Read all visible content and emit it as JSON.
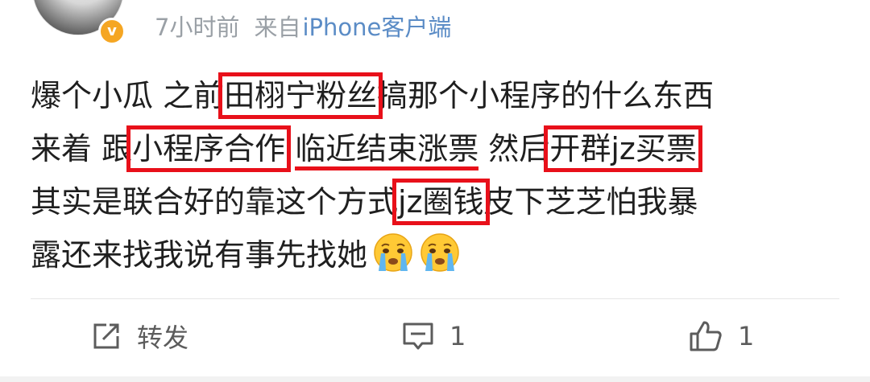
{
  "header": {
    "time": "7小时前",
    "source_prefix": "来自",
    "source_device": "iPhone客户端"
  },
  "vip_badge_letter": "v",
  "post": {
    "lines": [
      [
        "爆个小瓜 之前",
        "田栩宁粉丝",
        "搞那个小程序的什么东西"
      ],
      [
        "来着 跟",
        "小程序合作",
        " ",
        "临近结束涨票",
        " 然后",
        "开群jz买票"
      ],
      [
        "其实是联合好的靠这个方式",
        "jz圈钱",
        "皮下芝芝怕我暴"
      ],
      [
        "露还来找我说有事先找她"
      ]
    ]
  },
  "actions": {
    "repost_label": "转发",
    "comment_count": "1",
    "like_count": "1"
  },
  "colors": {
    "highlight": "#e8101a",
    "meta_gray": "#9aa0a6",
    "source_blue": "#5b8cc6",
    "text": "#1f1f1f"
  },
  "icons": [
    "repost-icon",
    "comment-icon",
    "like-icon",
    "crying-emoji-icon",
    "vip-badge-icon"
  ]
}
